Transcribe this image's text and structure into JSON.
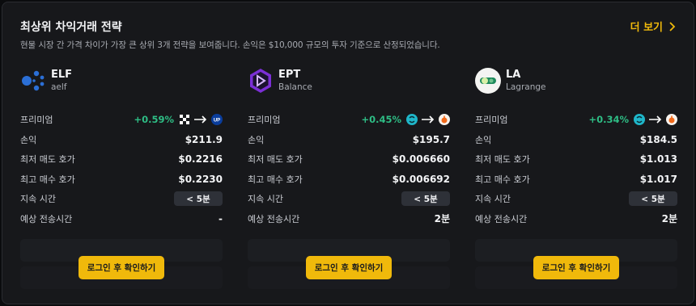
{
  "header": {
    "title": "최상위 차익거래 전략",
    "subtitle": "현물 시장 간 가격 차이가 가장 큰 상위 3개 전략을 보여줍니다. 손익은 $10,000 규모의 투자 기준으로 산정되었습니다.",
    "more_label": "더 보기"
  },
  "labels": {
    "premium": "프리미엄",
    "pnl": "손익",
    "lowest_ask": "최저 매도 호가",
    "highest_bid": "최고 매수 호가",
    "duration": "지속 시간",
    "transfer_time": "예상 전송시간",
    "login_button": "로그인 후 확인하기"
  },
  "strategies": [
    {
      "symbol": "ELF",
      "name": "aelf",
      "logo_icon": "elf-logo-icon",
      "premium": "+0.59%",
      "from_exchange_icon": "okx-exchange-icon",
      "to_exchange_icon": "upbit-exchange-icon",
      "pnl": "$211.9",
      "lowest_ask": "$0.2216",
      "highest_bid": "$0.2230",
      "duration": "< 5분",
      "transfer_time": "-"
    },
    {
      "symbol": "EPT",
      "name": "Balance",
      "logo_icon": "ept-logo-icon",
      "premium": "+0.45%",
      "from_exchange_icon": "swap-exchange-icon",
      "to_exchange_icon": "bithumb-exchange-icon",
      "pnl": "$195.7",
      "lowest_ask": "$0.006660",
      "highest_bid": "$0.006692",
      "duration": "< 5분",
      "transfer_time": "2분"
    },
    {
      "symbol": "LA",
      "name": "Lagrange",
      "logo_icon": "la-logo-icon",
      "premium": "+0.34%",
      "from_exchange_icon": "swap-exchange-icon",
      "to_exchange_icon": "bithumb-exchange-icon",
      "pnl": "$184.5",
      "lowest_ask": "$1.013",
      "highest_bid": "$1.017",
      "duration": "< 5분",
      "transfer_time": "2분"
    }
  ],
  "colors": {
    "accent": "#f0b90b",
    "positive": "#2ebd85",
    "background": "#17181b"
  }
}
